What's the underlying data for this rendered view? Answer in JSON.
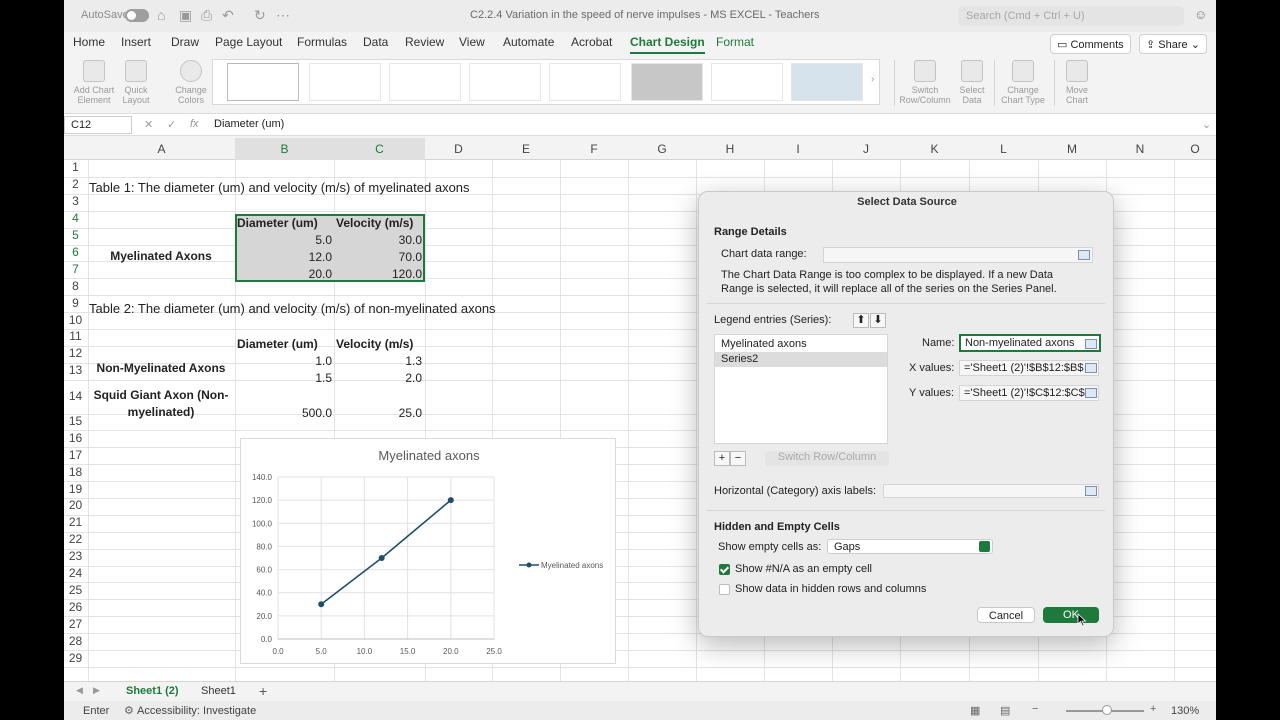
{
  "title_bar": {
    "autosave_label": "AutoSave",
    "document_title": "C2.2.4 Variation in the speed of nerve impulses - MS EXCEL - Teachers",
    "search_placeholder": "Search (Cmd + Ctrl + U)"
  },
  "tabs": [
    "Home",
    "Insert",
    "Draw",
    "Page Layout",
    "Formulas",
    "Data",
    "Review",
    "View",
    "Automate",
    "Acrobat",
    "Chart Design",
    "Format"
  ],
  "active_tab": "Chart Design",
  "header_buttons": {
    "comments": "Comments",
    "share": "Share"
  },
  "ribbon": {
    "add_chart_element": [
      "Add Chart",
      "Element"
    ],
    "quick_layout": [
      "Quick",
      "Layout"
    ],
    "change_colors": [
      "Change",
      "Colors"
    ],
    "switch_row_column": [
      "Switch",
      "Row/Column"
    ],
    "select_data": [
      "Select",
      "Data"
    ],
    "change_chart_type": [
      "Change",
      "Chart Type"
    ],
    "move_chart": [
      "Move",
      "Chart"
    ]
  },
  "formula_bar": {
    "name_box": "C12",
    "fx": "fx",
    "value": "Diameter (um)"
  },
  "columns": [
    "A",
    "B",
    "C",
    "D",
    "E",
    "F",
    "G",
    "H",
    "I",
    "J",
    "K",
    "L",
    "M",
    "N",
    "O"
  ],
  "rows": [
    "1",
    "2",
    "3",
    "4",
    "5",
    "6",
    "7",
    "8",
    "9",
    "10",
    "11",
    "12",
    "13",
    "14",
    "15",
    "16",
    "17",
    "18",
    "19",
    "20",
    "21",
    "22",
    "23",
    "24",
    "25",
    "26",
    "27",
    "28",
    "29"
  ],
  "sheet": {
    "table1_title": "Table 1: The diameter (um) and velocity (m/s) of myelinated axons",
    "table1_hdr_diameter": "Diameter (um)",
    "table1_hdr_velocity": "Velocity (m/s)",
    "myelinated_label": "Myelinated Axons",
    "t1_r5_b": "5.0",
    "t1_r5_c": "30.0",
    "t1_r6_b": "12.0",
    "t1_r6_c": "70.0",
    "t1_r7_b": "20.0",
    "t1_r7_c": "120.0",
    "table2_title": "Table 2: The diameter (um) and velocity (m/s) of non-myelinated axons",
    "table2_hdr_diameter": "Diameter (um)",
    "table2_hdr_velocity": "Velocity (m/s)",
    "non_myelinated_label": "Non-Myelinated Axons",
    "t2_r12_b": "1.0",
    "t2_r12_c": "1.3",
    "t2_r13_b": "1.5",
    "t2_r13_c": "2.0",
    "squid_label_1": "Squid Giant Axon (Non-",
    "squid_label_2": "myelinated)",
    "t2_r14_b": "500.0",
    "t2_r14_c": "25.0"
  },
  "chart_data": {
    "type": "line",
    "title": "Myelinated axons",
    "x": [
      5.0,
      12.0,
      20.0
    ],
    "series": [
      {
        "name": "Myelinated axons",
        "values": [
          30.0,
          70.0,
          120.0
        ]
      }
    ],
    "xlim": [
      0,
      25
    ],
    "ylim": [
      0,
      140
    ],
    "x_ticks": [
      "0.0",
      "5.0",
      "10.0",
      "15.0",
      "20.0",
      "25.0"
    ],
    "y_ticks": [
      "0.0",
      "20.0",
      "40.0",
      "60.0",
      "80.0",
      "100.0",
      "120.0",
      "140.0"
    ],
    "grid": true,
    "legend_position": "right",
    "line_color": "#1f4e6b"
  },
  "dialog": {
    "title": "Select Data Source",
    "range_details": "Range Details",
    "chart_data_range_label": "Chart data range:",
    "info_line1": "The Chart Data Range is too complex to be displayed. If a new Data",
    "info_line2": "Range is selected, it will replace all of the series on the Series Panel.",
    "legend_entries_label": "Legend entries (Series):",
    "series": [
      "Myelinated axons",
      "Series2"
    ],
    "name_label": "Name:",
    "name_value": "Non-myelinated axons",
    "x_values_label": "X values:",
    "x_values": "='Sheet1 (2)'!$B$12:$B$",
    "y_values_label": "Y values:",
    "y_values": "='Sheet1 (2)'!$C$12:$C$",
    "add": "+",
    "remove": "−",
    "switch_row_column": "Switch Row/Column",
    "category_axis_label": "Horizontal (Category) axis labels:",
    "hidden_empty": "Hidden and Empty Cells",
    "show_empty_label": "Show empty cells as:",
    "show_empty_value": "Gaps",
    "show_na_label": "Show #N/A as an empty cell",
    "show_hidden_label": "Show data in hidden rows and columns",
    "cancel": "Cancel",
    "ok": "OK"
  },
  "sheet_tabs": [
    "Sheet1 (2)",
    "Sheet1"
  ],
  "status_bar": {
    "mode": "Enter",
    "accessibility": "Accessibility: Investigate",
    "zoom": "130%"
  }
}
